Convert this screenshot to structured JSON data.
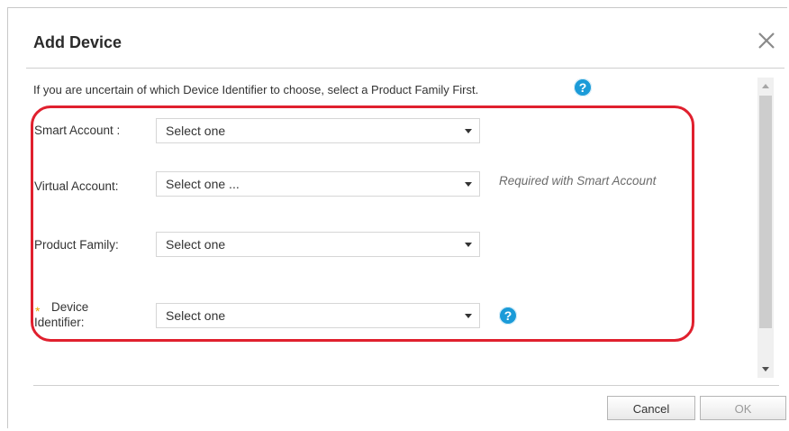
{
  "dialog": {
    "title": "Add Device",
    "info_text": "If you are uncertain of which Device Identifier to choose, select a Product Family First.",
    "fields": {
      "smart_account": {
        "label": "Smart Account :",
        "value": "Select one"
      },
      "virtual_account": {
        "label": "Virtual Account:",
        "value": "Select one ...",
        "hint": "Required with Smart Account"
      },
      "product_family": {
        "label": "Product Family:",
        "value": "Select one"
      },
      "device_identifier": {
        "label_line1": "Device",
        "label_line2": "Identifier:",
        "required_mark": "*",
        "value": "Select one"
      }
    },
    "buttons": {
      "cancel": "Cancel",
      "ok": "OK"
    },
    "close_glyph": "×",
    "help_glyph": "?"
  },
  "icons": {
    "help": "help-icon",
    "close": "close-icon",
    "dropdown": "chevron-down-icon"
  },
  "colors": {
    "help_blue": "#1b9bd8",
    "highlight_red": "#e0202e",
    "required_orange": "#e8a400"
  }
}
